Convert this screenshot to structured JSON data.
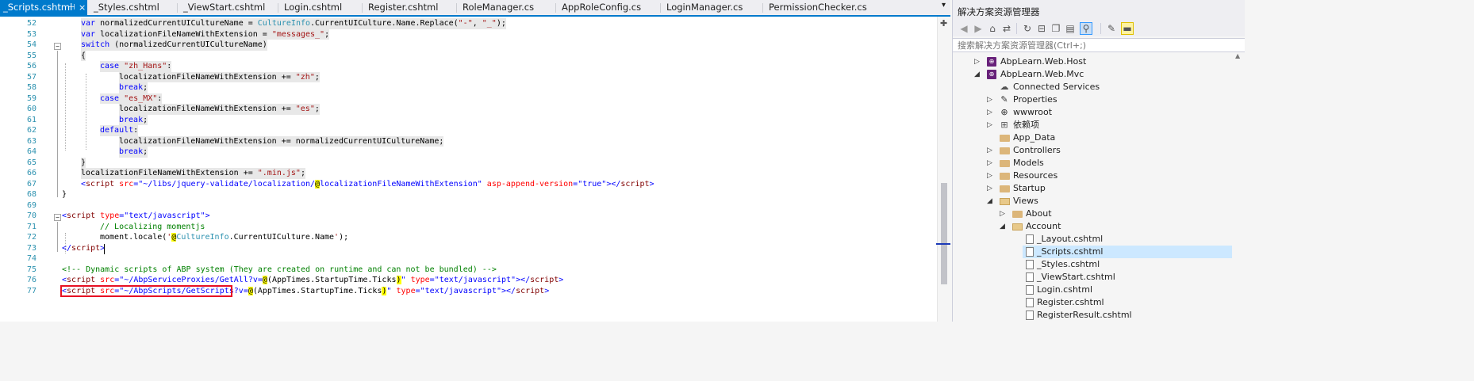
{
  "tabs": [
    {
      "label": "_Scripts.cshtml",
      "active": true
    },
    {
      "label": "_Styles.cshtml"
    },
    {
      "label": "_ViewStart.cshtml"
    },
    {
      "label": "Login.cshtml"
    },
    {
      "label": "Register.cshtml"
    },
    {
      "label": "RoleManager.cs"
    },
    {
      "label": "AppRoleConfig.cs"
    },
    {
      "label": "LoginManager.cs"
    },
    {
      "label": "PermissionChecker.cs"
    }
  ],
  "tab_icons": {
    "pin": "⊣",
    "close": "×",
    "overflow": "▾"
  },
  "line_numbers": [
    "52",
    "53",
    "54",
    "55",
    "56",
    "57",
    "58",
    "59",
    "60",
    "61",
    "62",
    "63",
    "64",
    "65",
    "66",
    "67",
    "68",
    "69",
    "70",
    "71",
    "72",
    "73",
    "74",
    "75",
    "76",
    "77"
  ],
  "code": {
    "l52a": "var ",
    "l52b": "normalizedCurrentUICultureName = ",
    "l52c": "CultureInfo",
    "l52d": ".CurrentUICulture.Name.Replace(",
    "l52e": "\"-\"",
    "l52f": ", ",
    "l52g": "\"_\"",
    "l52h": ");",
    "l53a": "var ",
    "l53b": "localizationFileNameWithExtension = ",
    "l53c": "\"messages_\"",
    "l53d": ";",
    "l54a": "switch ",
    "l54b": "(normalizedCurrentUICultureName)",
    "l55": "{",
    "l56a": "case ",
    "l56b": "\"zh_Hans\"",
    "l56c": ":",
    "l57a": "localizationFileNameWithExtension += ",
    "l57b": "\"zh\"",
    "l57c": ";",
    "l58a": "break",
    "l58b": ";",
    "l59a": "case ",
    "l59b": "\"es_MX\"",
    "l59c": ":",
    "l60a": "localizationFileNameWithExtension += ",
    "l60b": "\"es\"",
    "l60c": ";",
    "l61a": "break",
    "l61b": ";",
    "l62a": "default",
    "l62b": ":",
    "l63": "localizationFileNameWithExtension += normalizedCurrentUICultureName;",
    "l64a": "break",
    "l64b": ";",
    "l65": "}",
    "l66a": "localizationFileNameWithExtension += ",
    "l66b": "\".min.js\"",
    "l66c": ";",
    "l67a": "<",
    "l67b": "script",
    "l67c": " src",
    "l67d": "=",
    "l67e": "\"~/libs/jquery-validate/localization/",
    "l67f": "@",
    "l67g": "localizationFileNameWithExtension\"",
    "l67h": " asp-append-version",
    "l67i": "=",
    "l67j": "\"true\"",
    "l67k": "></",
    "l67l": "script",
    "l67m": ">",
    "l68": "}",
    "l70a": "<",
    "l70b": "script",
    "l70c": " type",
    "l70d": "=",
    "l70e": "\"text/javascript\"",
    "l70f": ">",
    "l71": "// Localizing momentjs",
    "l72a": "moment.locale(",
    "l72b": "'",
    "l72c": "@",
    "l72d": "CultureInfo",
    "l72e": ".CurrentUICulture.Name",
    "l72f": "'",
    "l72g": ");",
    "l73a": "</",
    "l73b": "script",
    "l73c": ">",
    "l75": "<!-- Dynamic scripts of ABP system (They are created on runtime and can not be bundled) -->",
    "l76a": "<",
    "l76b": "script",
    "l76c": " src",
    "l76d": "=",
    "l76e": "\"~/AbpServiceProxies/GetAll?v=",
    "l76f": "@",
    "l76g": "(AppTimes.StartupTime.Ticks",
    "l76h": ")",
    "l76i": "\"",
    "l76j": " type",
    "l76k": "=",
    "l76l": "\"text/javascript\"",
    "l76m": "></",
    "l76n": "script",
    "l76o": ">",
    "l77a": "<",
    "l77b": "script",
    "l77c": " src",
    "l77d": "=",
    "l77e": "\"~/AbpScripts/GetScripts",
    "l77f": "?v=",
    "l77g": "@",
    "l77h": "(AppTimes.StartupTime.Ticks",
    "l77i": ")",
    "l77j": "\"",
    "l77k": " type",
    "l77l": "=",
    "l77m": "\"text/javascript\"",
    "l77n": "></",
    "l77o": "script",
    "l77p": ">"
  },
  "solution_explorer": {
    "title": "解决方案资源管理器",
    "search_placeholder": "搜索解决方案资源管理器(Ctrl+;)",
    "toolbar_icons": [
      "back-icon",
      "forward-icon",
      "home-icon",
      "sync-icon",
      "history-icon",
      "collapse-icon",
      "show-all-icon",
      "properties-icon",
      "preview-icon"
    ],
    "items": [
      {
        "label": "AbpLearn.Web.Host",
        "expanded": false
      },
      {
        "label": "AbpLearn.Web.Mvc",
        "expanded": true
      },
      {
        "label": "Connected Services"
      },
      {
        "label": "Properties",
        "expanded": false
      },
      {
        "label": "wwwroot",
        "expanded": false
      },
      {
        "label": "依赖项",
        "expanded": false
      },
      {
        "label": "App_Data"
      },
      {
        "label": "Controllers",
        "expanded": false
      },
      {
        "label": "Models",
        "expanded": false
      },
      {
        "label": "Resources",
        "expanded": false
      },
      {
        "label": "Startup",
        "expanded": false
      },
      {
        "label": "Views",
        "expanded": true
      },
      {
        "label": "About",
        "expanded": false
      },
      {
        "label": "Account",
        "expanded": true
      },
      {
        "label": "_Layout.cshtml"
      },
      {
        "label": "_Scripts.cshtml",
        "selected": true
      },
      {
        "label": "_Styles.cshtml"
      },
      {
        "label": "_ViewStart.cshtml"
      },
      {
        "label": "Login.cshtml"
      },
      {
        "label": "Register.cshtml"
      },
      {
        "label": "RegisterResult.cshtml"
      }
    ]
  },
  "colors": {
    "accent": "#007acc",
    "selection": "#cce8ff",
    "highlight_box": "#e81123"
  }
}
